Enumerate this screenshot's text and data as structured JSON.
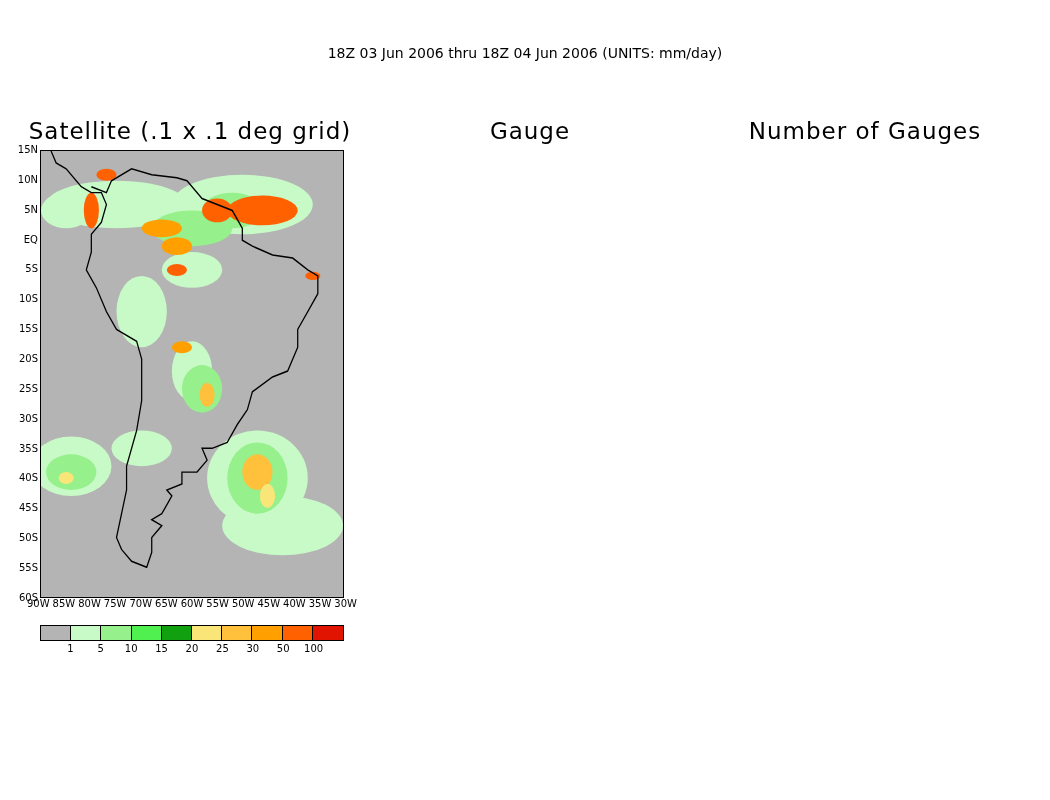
{
  "title": "18Z 03 Jun 2006 thru 18Z 04 Jun 2006 (UNITS: mm/day)",
  "panels": [
    {
      "title": "Satellite (.1 x .1 deg grid)",
      "kind": "map"
    },
    {
      "title": "Gauge",
      "kind": "empty"
    },
    {
      "title": "Number of Gauges",
      "kind": "empty"
    }
  ],
  "map": {
    "y_ticks": [
      "15N",
      "10N",
      "5N",
      "EQ",
      "5S",
      "10S",
      "15S",
      "20S",
      "25S",
      "30S",
      "35S",
      "40S",
      "45S",
      "50S",
      "55S",
      "60S"
    ],
    "x_ticks": [
      "90W",
      "85W",
      "80W",
      "75W",
      "70W",
      "65W",
      "60W",
      "55W",
      "50W",
      "45W",
      "40W",
      "35W",
      "30W"
    ]
  },
  "legend": {
    "bins": [
      {
        "color": "#b4b4b4"
      },
      {
        "color": "#c8fac8"
      },
      {
        "color": "#96f08c"
      },
      {
        "color": "#50f050"
      },
      {
        "color": "#10a010"
      },
      {
        "color": "#fae678"
      },
      {
        "color": "#ffc03c"
      },
      {
        "color": "#ffa000"
      },
      {
        "color": "#ff6000"
      },
      {
        "color": "#e01400"
      }
    ],
    "labels": [
      "1",
      "5",
      "10",
      "15",
      "20",
      "25",
      "30",
      "50",
      "100"
    ]
  }
}
